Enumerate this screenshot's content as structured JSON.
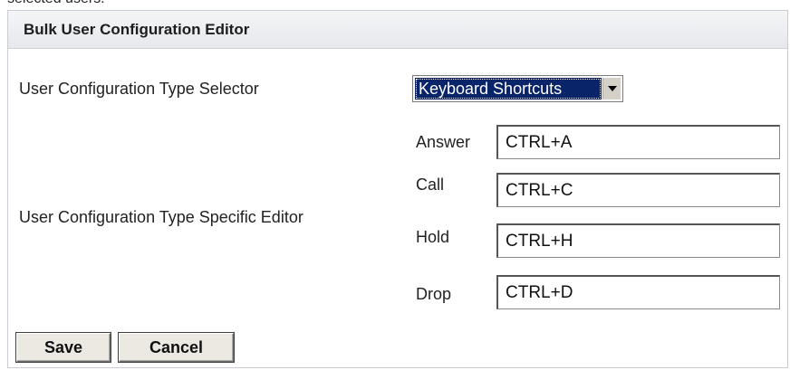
{
  "page": {
    "cut_text": "selected users."
  },
  "panel": {
    "title": "Bulk User Configuration Editor"
  },
  "selector": {
    "label": "User Configuration Type Selector",
    "selected": "Keyboard Shortcuts",
    "arrow_icon": "chevron-down-icon"
  },
  "editor": {
    "label": "User Configuration Type Specific Editor",
    "fields": [
      {
        "label": "Answer",
        "value": "CTRL+A"
      },
      {
        "label": "Call",
        "value": "CTRL+C"
      },
      {
        "label": "Hold",
        "value": "CTRL+H"
      },
      {
        "label": "Drop",
        "value": "CTRL+D"
      }
    ]
  },
  "actions": {
    "save_label": "Save",
    "cancel_label": "Cancel"
  },
  "colors": {
    "selection_bg": "#0a246a",
    "header_bg": "#e6e8ec"
  }
}
